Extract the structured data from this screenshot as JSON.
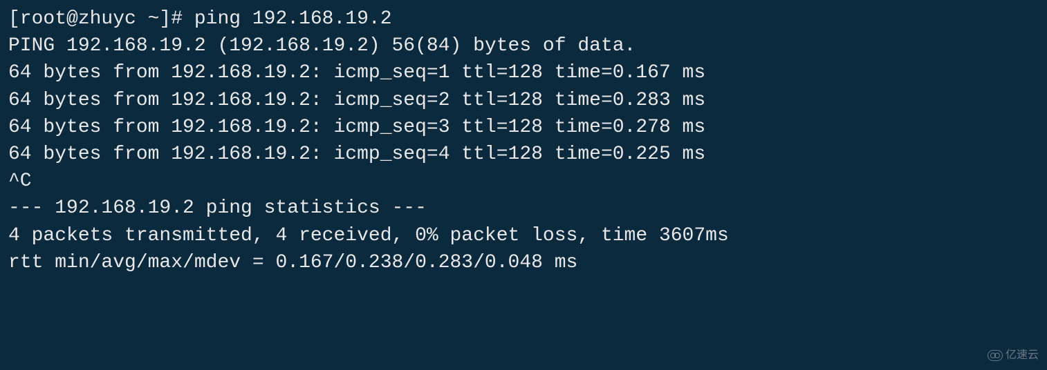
{
  "terminal": {
    "prompt": "[root@zhuyc ~]# ",
    "command": "ping 192.168.19.2",
    "output": {
      "header": "PING 192.168.19.2 (192.168.19.2) 56(84) bytes of data.",
      "replies": [
        "64 bytes from 192.168.19.2: icmp_seq=1 ttl=128 time=0.167 ms",
        "64 bytes from 192.168.19.2: icmp_seq=2 ttl=128 time=0.283 ms",
        "64 bytes from 192.168.19.2: icmp_seq=3 ttl=128 time=0.278 ms",
        "64 bytes from 192.168.19.2: icmp_seq=4 ttl=128 time=0.225 ms"
      ],
      "interrupt": "^C",
      "stats_header": "--- 192.168.19.2 ping statistics ---",
      "stats_summary": "4 packets transmitted, 4 received, 0% packet loss, time 3607ms",
      "rtt": "rtt min/avg/max/mdev = 0.167/0.238/0.283/0.048 ms"
    }
  },
  "watermark": {
    "text": "亿速云"
  }
}
